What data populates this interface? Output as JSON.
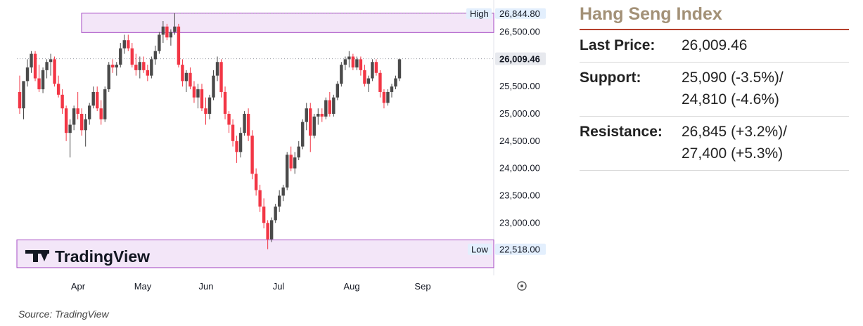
{
  "chart_data": {
    "type": "candlestick",
    "x_tick_labels": [
      "Apr",
      "May",
      "Jun",
      "Jul",
      "Aug",
      "Sep"
    ],
    "y_tick_labels": [
      "26,500.00",
      "25,500.00",
      "25,000.00",
      "24,500.00",
      "24,000.00",
      "23,500.00",
      "23,000.00"
    ],
    "ylim": [
      22150,
      26950
    ],
    "high": {
      "label": "High",
      "value": "26,844.80",
      "band": [
        26490,
        26844.8
      ]
    },
    "low": {
      "label": "Low",
      "value": "22,518.00",
      "band": [
        22180,
        22690
      ]
    },
    "last_price_value": 26009.46,
    "last_price_label": "26,009.46",
    "watermark": "TradingView",
    "candles": [
      [
        25400,
        25700,
        25000,
        25100
      ],
      [
        25100,
        25600,
        24900,
        25600
      ],
      [
        25600,
        26000,
        25500,
        25850
      ],
      [
        25850,
        26150,
        25750,
        26100
      ],
      [
        26100,
        26150,
        25600,
        25650
      ],
      [
        25650,
        25900,
        25400,
        25450
      ],
      [
        25450,
        25850,
        25380,
        25800
      ],
      [
        25800,
        26000,
        25650,
        25950
      ],
      [
        25950,
        26100,
        25700,
        26000
      ],
      [
        26000,
        26050,
        25500,
        25550
      ],
      [
        25550,
        25700,
        25300,
        25350
      ],
      [
        25350,
        25450,
        25000,
        25100
      ],
      [
        25100,
        25150,
        24500,
        24650
      ],
      [
        24650,
        24900,
        24200,
        24800
      ],
      [
        24800,
        25150,
        24700,
        25100
      ],
      [
        25100,
        25400,
        24900,
        25000
      ],
      [
        25000,
        25100,
        24600,
        24700
      ],
      [
        24700,
        25000,
        24400,
        24900
      ],
      [
        24900,
        25200,
        24800,
        25150
      ],
      [
        25150,
        25500,
        25100,
        25400
      ],
      [
        25400,
        25500,
        25050,
        25100
      ],
      [
        25100,
        25250,
        24800,
        24900
      ],
      [
        24900,
        25500,
        24850,
        25450
      ],
      [
        25450,
        25950,
        25400,
        25900
      ],
      [
        25900,
        26000,
        25750,
        25850
      ],
      [
        25850,
        25950,
        25700,
        25900
      ],
      [
        25900,
        26300,
        25850,
        26200
      ],
      [
        26200,
        26450,
        26100,
        26350
      ],
      [
        26350,
        26450,
        26150,
        26200
      ],
      [
        26200,
        26300,
        25850,
        25900
      ],
      [
        25900,
        26100,
        25700,
        25800
      ],
      [
        25800,
        26050,
        25650,
        25950
      ],
      [
        25950,
        26050,
        25750,
        25800
      ],
      [
        25800,
        25900,
        25600,
        25700
      ],
      [
        25700,
        26050,
        25650,
        26000
      ],
      [
        26000,
        26250,
        25900,
        26150
      ],
      [
        26150,
        26500,
        26100,
        26450
      ],
      [
        26450,
        26700,
        26300,
        26600
      ],
      [
        26600,
        26650,
        26350,
        26400
      ],
      [
        26400,
        26550,
        26250,
        26500
      ],
      [
        26500,
        26844.8,
        26450,
        26600
      ],
      [
        26600,
        26650,
        25850,
        25900
      ],
      [
        25900,
        26000,
        25500,
        25600
      ],
      [
        25600,
        25800,
        25400,
        25750
      ],
      [
        25750,
        25850,
        25450,
        25500
      ],
      [
        25500,
        25600,
        25200,
        25300
      ],
      [
        25300,
        25550,
        25100,
        25450
      ],
      [
        25450,
        25550,
        25050,
        25100
      ],
      [
        25100,
        25300,
        24800,
        25000
      ],
      [
        25000,
        25350,
        24900,
        25300
      ],
      [
        25300,
        25800,
        25250,
        25700
      ],
      [
        25700,
        26050,
        25600,
        25950
      ],
      [
        25950,
        26000,
        25300,
        25400
      ],
      [
        25400,
        25500,
        24900,
        25000
      ],
      [
        25000,
        25050,
        24650,
        24800
      ],
      [
        24800,
        24900,
        24400,
        24500
      ],
      [
        24500,
        24600,
        24100,
        24300
      ],
      [
        24300,
        24750,
        24200,
        24650
      ],
      [
        24650,
        25050,
        24600,
        25000
      ],
      [
        25000,
        25100,
        24500,
        24600
      ],
      [
        24600,
        24700,
        23800,
        23900
      ],
      [
        23900,
        24000,
        23500,
        23600
      ],
      [
        23600,
        23700,
        23200,
        23300
      ],
      [
        23300,
        23450,
        22900,
        23000
      ],
      [
        23000,
        23050,
        22518,
        22700
      ],
      [
        22700,
        23100,
        22650,
        23050
      ],
      [
        23050,
        23350,
        23000,
        23300
      ],
      [
        23300,
        23600,
        23200,
        23500
      ],
      [
        23500,
        23700,
        23400,
        23650
      ],
      [
        23650,
        24300,
        23600,
        24250
      ],
      [
        24250,
        24400,
        23950,
        24000
      ],
      [
        24000,
        24300,
        23900,
        24200
      ],
      [
        24200,
        24500,
        24150,
        24400
      ],
      [
        24400,
        24900,
        24350,
        24850
      ],
      [
        24850,
        25200,
        24700,
        25100
      ],
      [
        25100,
        25200,
        24300,
        24600
      ],
      [
        24600,
        25000,
        24550,
        24950
      ],
      [
        24950,
        25100,
        24800,
        25000
      ],
      [
        25000,
        25100,
        24850,
        24950
      ],
      [
        24950,
        25300,
        24900,
        25250
      ],
      [
        25250,
        25400,
        24950,
        25000
      ],
      [
        25000,
        25350,
        24950,
        25300
      ],
      [
        25300,
        25600,
        25250,
        25550
      ],
      [
        25550,
        25950,
        25500,
        25900
      ],
      [
        25900,
        26050,
        25800,
        26000
      ],
      [
        26000,
        26150,
        25850,
        26050
      ],
      [
        26050,
        26100,
        25800,
        25850
      ],
      [
        25850,
        26050,
        25800,
        26000
      ],
      [
        26000,
        26050,
        25700,
        25800
      ],
      [
        25800,
        25900,
        25500,
        25550
      ],
      [
        25550,
        25700,
        25400,
        25650
      ],
      [
        25650,
        26000,
        25600,
        25950
      ],
      [
        25950,
        26000,
        25700,
        25750
      ],
      [
        25750,
        25800,
        25300,
        25400
      ],
      [
        25400,
        25450,
        25100,
        25200
      ],
      [
        25200,
        25450,
        25150,
        25400
      ],
      [
        25400,
        25550,
        25300,
        25500
      ],
      [
        25500,
        25700,
        25450,
        25650
      ],
      [
        25650,
        26009.46,
        25600,
        26000
      ]
    ]
  },
  "panel": {
    "title": "Hang Seng Index",
    "rows": [
      {
        "label": "Last Price:",
        "lines": [
          "26,009.46"
        ]
      },
      {
        "label": "Support:",
        "lines": [
          "25,090 (-3.5%)/",
          "24,810 (-4.6%)"
        ]
      },
      {
        "label": "Resistance:",
        "lines": [
          "26,845 (+3.2%)/",
          "27,400 (+5.3%)"
        ]
      }
    ]
  },
  "source": "Source: TradingView"
}
